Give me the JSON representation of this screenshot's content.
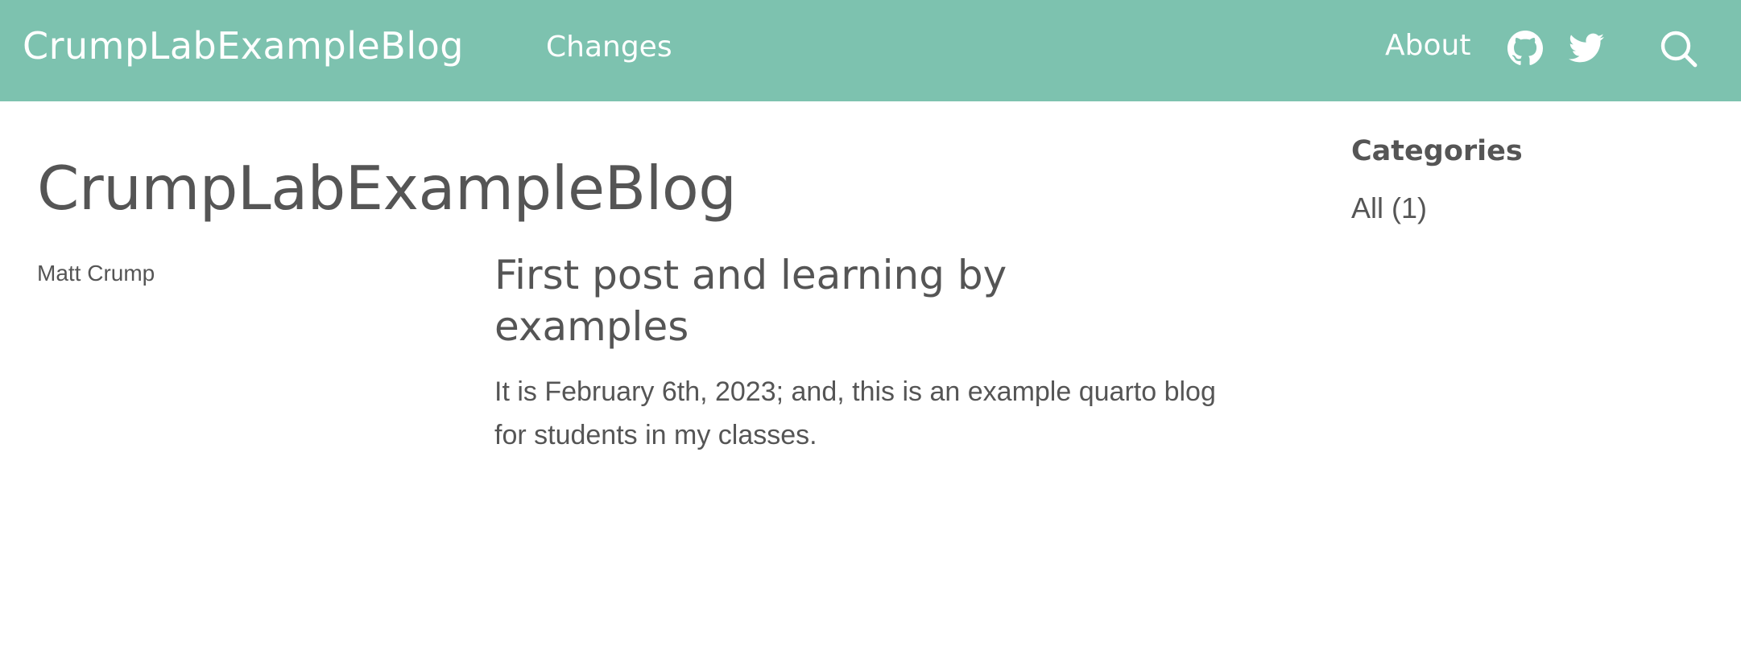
{
  "navbar": {
    "brand": "CrumpLabExampleBlog",
    "links": {
      "changes": "Changes",
      "about": "About"
    },
    "icons": [
      "github-icon",
      "twitter-icon",
      "search-icon"
    ],
    "background_color": "#7dc2af"
  },
  "main": {
    "title": "CrumpLabExampleBlog",
    "author": "Matt Crump",
    "post": {
      "title": "First post and learning by examples",
      "description": "It is February 6th, 2023; and, this is an example quarto blog for students in my classes."
    }
  },
  "sidebar": {
    "heading": "Categories",
    "items": [
      {
        "label": "All (1)"
      }
    ]
  },
  "colors": {
    "text": "#555555",
    "nav_text": "#ffffff"
  }
}
